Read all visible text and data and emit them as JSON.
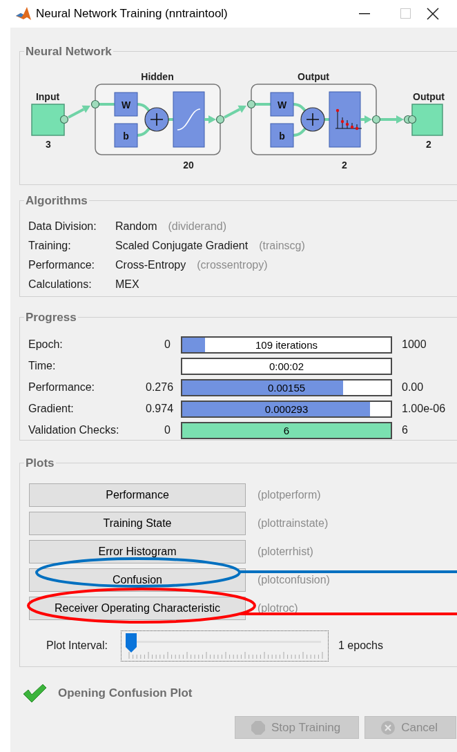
{
  "window": {
    "title": "Neural Network Training (nntraintool)"
  },
  "neural_network": {
    "title": "Neural Network",
    "input": {
      "label": "Input",
      "size": "3"
    },
    "layers": [
      {
        "title": "Hidden",
        "weight": "W",
        "bias": "b",
        "size": "20",
        "kind": "sigmoid"
      },
      {
        "title": "Output",
        "weight": "W",
        "bias": "b",
        "size": "2",
        "kind": "softmax"
      }
    ],
    "output": {
      "label": "Output",
      "size": "2"
    }
  },
  "algorithms": {
    "title": "Algorithms",
    "rows": [
      {
        "label": "Data Division:",
        "value": "Random",
        "function": "(dividerand)"
      },
      {
        "label": "Training:",
        "value": "Scaled Conjugate Gradient",
        "function": "(trainscg)"
      },
      {
        "label": "Performance:",
        "value": "Cross-Entropy",
        "function": "(crossentropy)"
      },
      {
        "label": "Calculations:",
        "value": "MEX"
      }
    ]
  },
  "progress": {
    "title": "Progress",
    "rows": [
      {
        "label": "Epoch:",
        "start": "0",
        "reading": "109 iterations",
        "end": "1000",
        "level": 0.109,
        "color": "#7192e0"
      },
      {
        "label": "Time:",
        "reading": "0:00:02"
      },
      {
        "label": "Performance:",
        "start": "0.276",
        "reading": "0.00155",
        "end": "0.00",
        "level": 0.77,
        "color": "#7192e0"
      },
      {
        "label": "Gradient:",
        "start": "0.974",
        "reading": "0.000293",
        "end": "1.00e-06",
        "level": 0.9,
        "color": "#7192e0"
      },
      {
        "label": "Validation Checks:",
        "start": "0",
        "reading": "6",
        "end": "6",
        "level": 1,
        "color": "#7ae0b0"
      }
    ]
  },
  "plots": {
    "title": "Plots",
    "buttons": [
      {
        "label": "Performance",
        "function": "(plotperform)"
      },
      {
        "label": "Training State",
        "function": "(plottrainstate)"
      },
      {
        "label": "Error Histogram",
        "function": "(ploterrhist)"
      },
      {
        "label": "Confusion",
        "function": "(plotconfusion)"
      },
      {
        "label": "Receiver Operating Characteristic",
        "function": "(plotroc)"
      }
    ],
    "interval": {
      "label": "Plot Interval:",
      "level": 0,
      "reading": "1 epochs"
    }
  },
  "status": {
    "text": "Opening Confusion Plot"
  },
  "buttons": [
    {
      "label": "Stop Training",
      "kind": "stop",
      "disabled": true
    },
    {
      "label": "Cancel",
      "kind": "cancel",
      "disabled": true
    }
  ],
  "annotations": [
    {
      "color": "#0070c0"
    },
    {
      "color": "#ff0000"
    }
  ]
}
